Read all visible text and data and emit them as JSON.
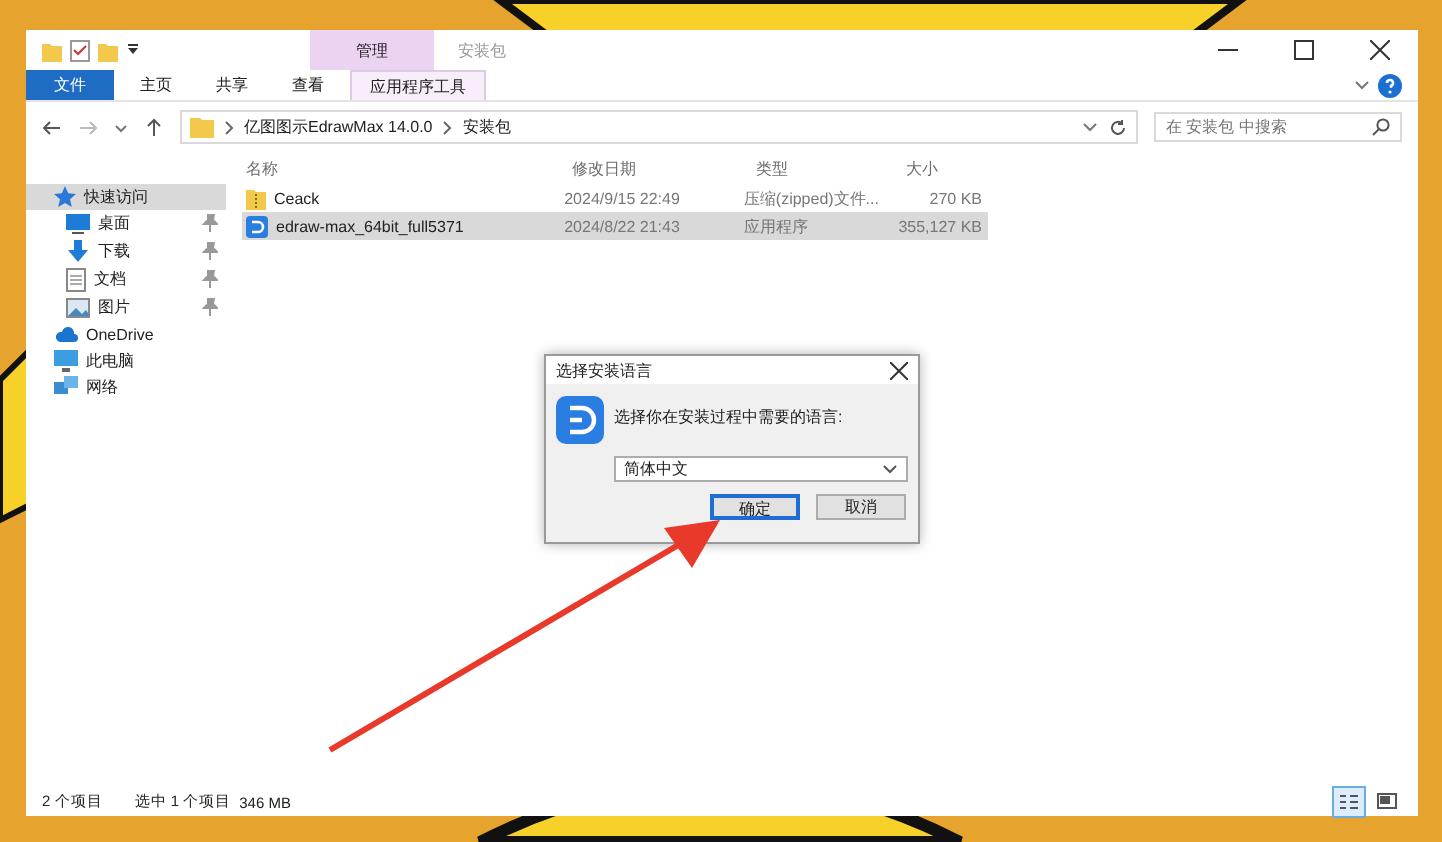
{
  "window": {
    "title": "安装包",
    "context_group": "管理"
  },
  "ribbon": {
    "tabs": [
      {
        "label": "文件",
        "kind": "file"
      },
      {
        "label": "主页",
        "kind": "normal"
      },
      {
        "label": "共享",
        "kind": "normal"
      },
      {
        "label": "查看",
        "kind": "normal"
      },
      {
        "label": "应用程序工具",
        "kind": "contextual"
      }
    ]
  },
  "address": {
    "path": [
      "亿图图示EdrawMax 14.0.0",
      "安装包"
    ],
    "search_placeholder": "在 安装包 中搜索"
  },
  "sidebar": {
    "items": [
      {
        "label": "快速访问",
        "kind": "star",
        "selected": true,
        "children": [
          {
            "label": "桌面",
            "kind": "desktop",
            "pinned": true
          },
          {
            "label": "下载",
            "kind": "download",
            "pinned": true
          },
          {
            "label": "文档",
            "kind": "document",
            "pinned": true
          },
          {
            "label": "图片",
            "kind": "picture",
            "pinned": true
          }
        ]
      },
      {
        "label": "OneDrive",
        "kind": "cloud",
        "selected": false
      },
      {
        "label": "此电脑",
        "kind": "computer",
        "selected": false
      },
      {
        "label": "网络",
        "kind": "network",
        "selected": false
      }
    ]
  },
  "table": {
    "columns": [
      "名称",
      "修改日期",
      "类型",
      "大小"
    ],
    "rows": [
      {
        "kind": "zip",
        "name": "Ceack",
        "date": "2024/9/15 22:49",
        "type": "压缩(zipped)文件...",
        "size": "270 KB",
        "selected": false
      },
      {
        "kind": "app",
        "name": "edraw-max_64bit_full5371",
        "date": "2024/8/22 21:43",
        "type": "应用程序",
        "size": "355,127 KB",
        "selected": true
      }
    ]
  },
  "status_bar": {
    "count": "2 个项目",
    "selection": "选中 1 个项目",
    "selection_size": "346 MB"
  },
  "dialog": {
    "title": "选择安装语言",
    "prompt": "选择你在安装过程中需要的语言:",
    "language": "简体中文",
    "buttons": [
      {
        "label": "确定",
        "focused": true
      },
      {
        "label": "取消",
        "focused": false
      }
    ]
  }
}
